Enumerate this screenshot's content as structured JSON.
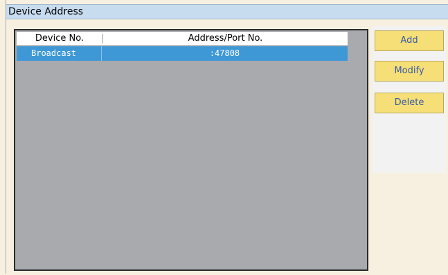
{
  "panel": {
    "title": "Device Address"
  },
  "table": {
    "columns": [
      "Device No.",
      "Address/Port No."
    ],
    "rows": [
      {
        "device_no": "Broadcast",
        "address_port": ":47808",
        "selected": true
      }
    ]
  },
  "buttons": {
    "add": "Add",
    "modify": "Modify",
    "delete": "Delete"
  },
  "colors": {
    "header_bg": "#c8dcf0",
    "selection": "#3f98d6",
    "button_bg": "#f5df76",
    "button_text": "#395aa6",
    "list_bg": "#a9aaad",
    "page_bg": "#f7f0e1"
  }
}
